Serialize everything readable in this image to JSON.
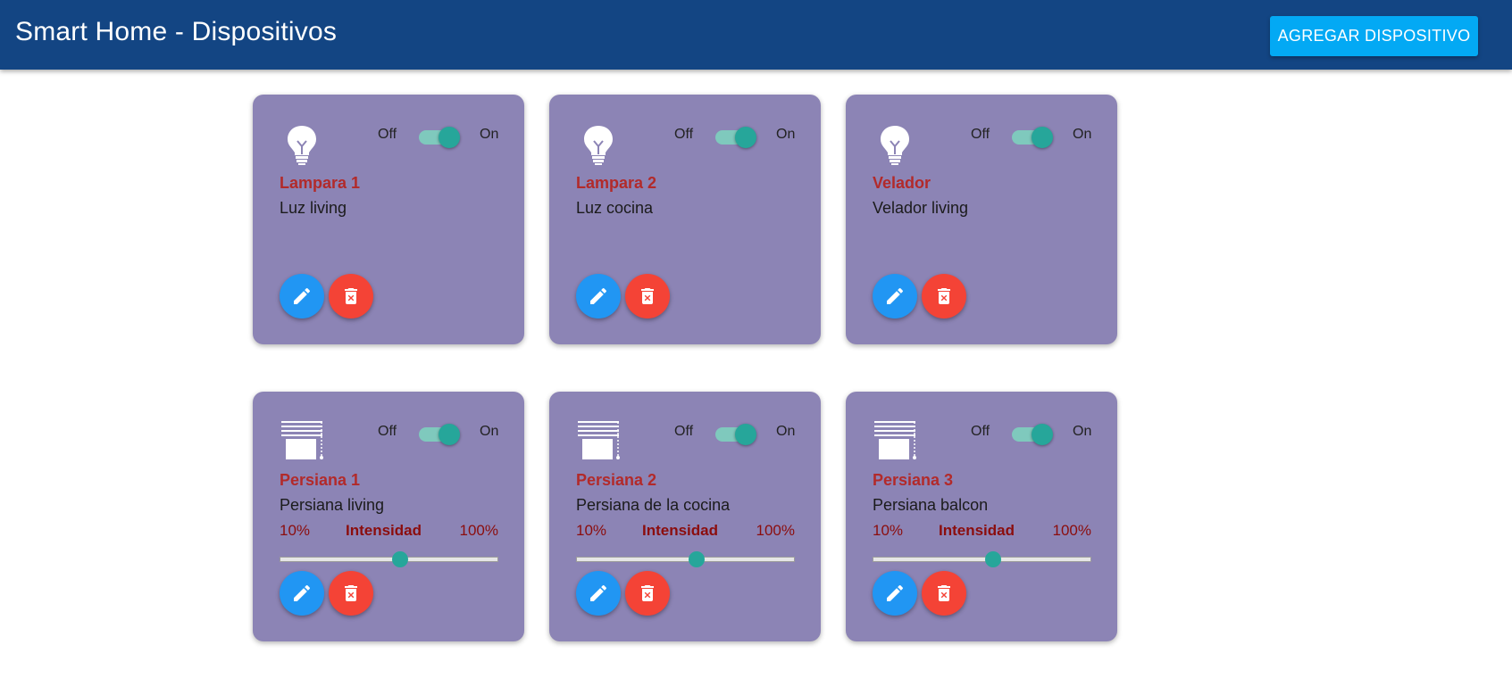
{
  "app": {
    "title": "Smart Home - Dispositivos",
    "add_button_label": "AGREGAR DISPOSITIVO",
    "colors": {
      "appbar": "#134583",
      "accent_button": "#03a9f4",
      "card_background": "#8c84b5",
      "device_name": "#b22a2a",
      "switch_on": "#26a69a",
      "edit_button": "#2196f3",
      "delete_button": "#f44336"
    }
  },
  "devices": [
    {
      "icon": "lightbulb-icon",
      "name": "Lampara 1",
      "description": "Luz living",
      "toggle": {
        "off_label": "Off",
        "on_label": "On",
        "state": "on"
      }
    },
    {
      "icon": "lightbulb-icon",
      "name": "Lampara 2",
      "description": "Luz cocina",
      "toggle": {
        "off_label": "Off",
        "on_label": "On",
        "state": "on"
      }
    },
    {
      "icon": "lightbulb-icon",
      "name": "Velador",
      "description": "Velador living",
      "toggle": {
        "off_label": "Off",
        "on_label": "On",
        "state": "on"
      }
    },
    {
      "icon": "blinds-icon",
      "name": "Persiana 1",
      "description": "Persiana living",
      "toggle": {
        "off_label": "Off",
        "on_label": "On",
        "state": "on"
      },
      "intensity": {
        "min_label": "10%",
        "label": "Intensidad",
        "max_label": "100%",
        "level": 0.55
      }
    },
    {
      "icon": "blinds-icon",
      "name": "Persiana 2",
      "description": "Persiana de la cocina",
      "toggle": {
        "off_label": "Off",
        "on_label": "On",
        "state": "on"
      },
      "intensity": {
        "min_label": "10%",
        "label": "Intensidad",
        "max_label": "100%",
        "level": 0.55
      }
    },
    {
      "icon": "blinds-icon",
      "name": "Persiana 3",
      "description": "Persiana balcon",
      "toggle": {
        "off_label": "Off",
        "on_label": "On",
        "state": "on"
      },
      "intensity": {
        "min_label": "10%",
        "label": "Intensidad",
        "max_label": "100%",
        "level": 0.55
      }
    }
  ]
}
